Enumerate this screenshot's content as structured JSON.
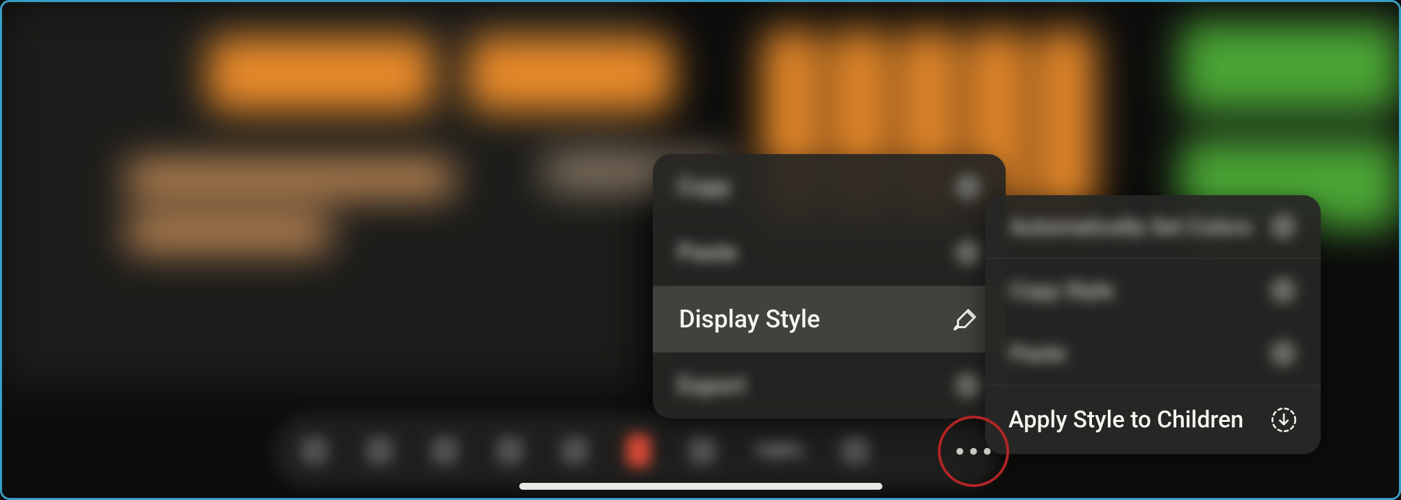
{
  "menu1": {
    "copy": {
      "label": "Copy"
    },
    "paste": {
      "label": "Paste"
    },
    "display_style": {
      "label": "Display Style"
    },
    "export": {
      "label": "Export"
    }
  },
  "menu2": {
    "auto_colors": {
      "label": "Automatically Set Colors"
    },
    "copy_style": {
      "label": "Copy Style"
    },
    "paste_style": {
      "label": "Paste"
    },
    "apply_children": {
      "label": "Apply Style to Children"
    }
  },
  "toolbar": {
    "zoom_label": "100%"
  },
  "icons": {
    "paintbrush": "paintbrush-icon",
    "apply_down": "apply-down-icon",
    "more": "more-icon"
  },
  "colors": {
    "accent_orange": "#e88a2a",
    "accent_green": "#4aa535",
    "accent_red": "#b02525",
    "frame_border": "#3a9fc5"
  }
}
